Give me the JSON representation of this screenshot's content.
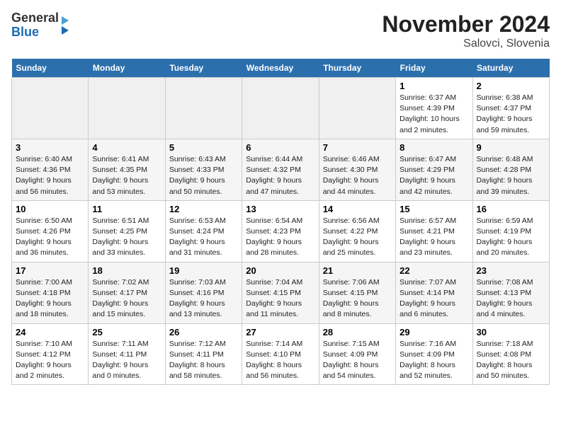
{
  "header": {
    "logo_general": "General",
    "logo_blue": "Blue",
    "title": "November 2024",
    "subtitle": "Salovci, Slovenia"
  },
  "days_of_week": [
    "Sunday",
    "Monday",
    "Tuesday",
    "Wednesday",
    "Thursday",
    "Friday",
    "Saturday"
  ],
  "weeks": [
    [
      {
        "day": "",
        "info": ""
      },
      {
        "day": "",
        "info": ""
      },
      {
        "day": "",
        "info": ""
      },
      {
        "day": "",
        "info": ""
      },
      {
        "day": "",
        "info": ""
      },
      {
        "day": "1",
        "info": "Sunrise: 6:37 AM\nSunset: 4:39 PM\nDaylight: 10 hours and 2 minutes."
      },
      {
        "day": "2",
        "info": "Sunrise: 6:38 AM\nSunset: 4:37 PM\nDaylight: 9 hours and 59 minutes."
      }
    ],
    [
      {
        "day": "3",
        "info": "Sunrise: 6:40 AM\nSunset: 4:36 PM\nDaylight: 9 hours and 56 minutes."
      },
      {
        "day": "4",
        "info": "Sunrise: 6:41 AM\nSunset: 4:35 PM\nDaylight: 9 hours and 53 minutes."
      },
      {
        "day": "5",
        "info": "Sunrise: 6:43 AM\nSunset: 4:33 PM\nDaylight: 9 hours and 50 minutes."
      },
      {
        "day": "6",
        "info": "Sunrise: 6:44 AM\nSunset: 4:32 PM\nDaylight: 9 hours and 47 minutes."
      },
      {
        "day": "7",
        "info": "Sunrise: 6:46 AM\nSunset: 4:30 PM\nDaylight: 9 hours and 44 minutes."
      },
      {
        "day": "8",
        "info": "Sunrise: 6:47 AM\nSunset: 4:29 PM\nDaylight: 9 hours and 42 minutes."
      },
      {
        "day": "9",
        "info": "Sunrise: 6:48 AM\nSunset: 4:28 PM\nDaylight: 9 hours and 39 minutes."
      }
    ],
    [
      {
        "day": "10",
        "info": "Sunrise: 6:50 AM\nSunset: 4:26 PM\nDaylight: 9 hours and 36 minutes."
      },
      {
        "day": "11",
        "info": "Sunrise: 6:51 AM\nSunset: 4:25 PM\nDaylight: 9 hours and 33 minutes."
      },
      {
        "day": "12",
        "info": "Sunrise: 6:53 AM\nSunset: 4:24 PM\nDaylight: 9 hours and 31 minutes."
      },
      {
        "day": "13",
        "info": "Sunrise: 6:54 AM\nSunset: 4:23 PM\nDaylight: 9 hours and 28 minutes."
      },
      {
        "day": "14",
        "info": "Sunrise: 6:56 AM\nSunset: 4:22 PM\nDaylight: 9 hours and 25 minutes."
      },
      {
        "day": "15",
        "info": "Sunrise: 6:57 AM\nSunset: 4:21 PM\nDaylight: 9 hours and 23 minutes."
      },
      {
        "day": "16",
        "info": "Sunrise: 6:59 AM\nSunset: 4:19 PM\nDaylight: 9 hours and 20 minutes."
      }
    ],
    [
      {
        "day": "17",
        "info": "Sunrise: 7:00 AM\nSunset: 4:18 PM\nDaylight: 9 hours and 18 minutes."
      },
      {
        "day": "18",
        "info": "Sunrise: 7:02 AM\nSunset: 4:17 PM\nDaylight: 9 hours and 15 minutes."
      },
      {
        "day": "19",
        "info": "Sunrise: 7:03 AM\nSunset: 4:16 PM\nDaylight: 9 hours and 13 minutes."
      },
      {
        "day": "20",
        "info": "Sunrise: 7:04 AM\nSunset: 4:15 PM\nDaylight: 9 hours and 11 minutes."
      },
      {
        "day": "21",
        "info": "Sunrise: 7:06 AM\nSunset: 4:15 PM\nDaylight: 9 hours and 8 minutes."
      },
      {
        "day": "22",
        "info": "Sunrise: 7:07 AM\nSunset: 4:14 PM\nDaylight: 9 hours and 6 minutes."
      },
      {
        "day": "23",
        "info": "Sunrise: 7:08 AM\nSunset: 4:13 PM\nDaylight: 9 hours and 4 minutes."
      }
    ],
    [
      {
        "day": "24",
        "info": "Sunrise: 7:10 AM\nSunset: 4:12 PM\nDaylight: 9 hours and 2 minutes."
      },
      {
        "day": "25",
        "info": "Sunrise: 7:11 AM\nSunset: 4:11 PM\nDaylight: 9 hours and 0 minutes."
      },
      {
        "day": "26",
        "info": "Sunrise: 7:12 AM\nSunset: 4:11 PM\nDaylight: 8 hours and 58 minutes."
      },
      {
        "day": "27",
        "info": "Sunrise: 7:14 AM\nSunset: 4:10 PM\nDaylight: 8 hours and 56 minutes."
      },
      {
        "day": "28",
        "info": "Sunrise: 7:15 AM\nSunset: 4:09 PM\nDaylight: 8 hours and 54 minutes."
      },
      {
        "day": "29",
        "info": "Sunrise: 7:16 AM\nSunset: 4:09 PM\nDaylight: 8 hours and 52 minutes."
      },
      {
        "day": "30",
        "info": "Sunrise: 7:18 AM\nSunset: 4:08 PM\nDaylight: 8 hours and 50 minutes."
      }
    ]
  ]
}
